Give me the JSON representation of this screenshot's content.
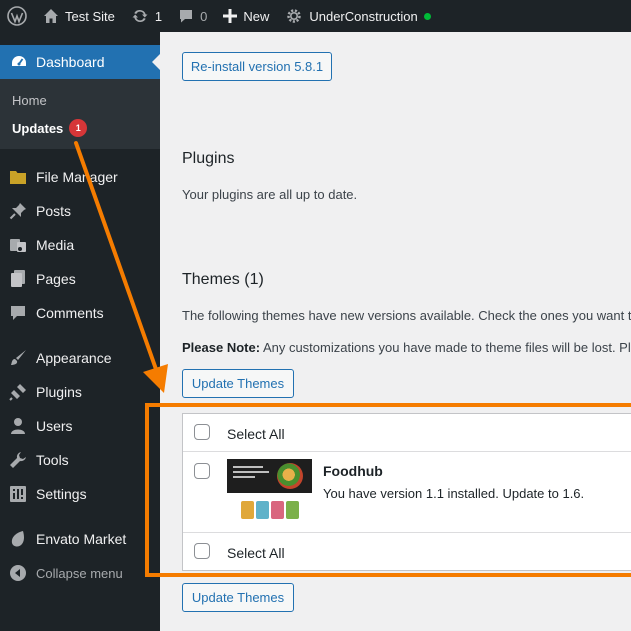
{
  "adminbar": {
    "site_name": "Test Site",
    "updates_count": "1",
    "comments_count": "0",
    "new_label": "New",
    "plugin_label": "UnderConstruction"
  },
  "sidebar": {
    "dashboard": "Dashboard",
    "submenu": {
      "home": "Home",
      "updates": "Updates",
      "updates_badge": "1"
    },
    "items": [
      {
        "label": "File Manager",
        "icon": "folder-icon"
      },
      {
        "label": "Posts",
        "icon": "pin-icon"
      },
      {
        "label": "Media",
        "icon": "media-icon"
      },
      {
        "label": "Pages",
        "icon": "pages-icon"
      },
      {
        "label": "Comments",
        "icon": "comment-icon"
      },
      {
        "label": "Appearance",
        "icon": "brush-icon"
      },
      {
        "label": "Plugins",
        "icon": "plug-icon"
      },
      {
        "label": "Users",
        "icon": "user-icon"
      },
      {
        "label": "Tools",
        "icon": "wrench-icon"
      },
      {
        "label": "Settings",
        "icon": "settings-icon"
      },
      {
        "label": "Envato Market",
        "icon": "leaf-icon"
      }
    ],
    "collapse": "Collapse menu"
  },
  "main": {
    "reinstall_button": "Re-install version 5.8.1",
    "plugins": {
      "heading": "Plugins",
      "text": "Your plugins are all up to date."
    },
    "themes": {
      "heading": "Themes (1)",
      "intro": "The following themes have new versions available. Check the ones you want to",
      "note_label": "Please Note:",
      "note_text": " Any customizations you have made to theme files will be lost. Ple",
      "update_button": "Update Themes",
      "select_all": "Select All",
      "theme": {
        "name": "Foodhub",
        "description": "You have version 1.1 installed. Update to 1.6."
      }
    }
  },
  "colors": {
    "accent": "#2271b1",
    "annotation": "#f57c00",
    "badge": "#d63638",
    "sidebar": "#1d2327"
  }
}
